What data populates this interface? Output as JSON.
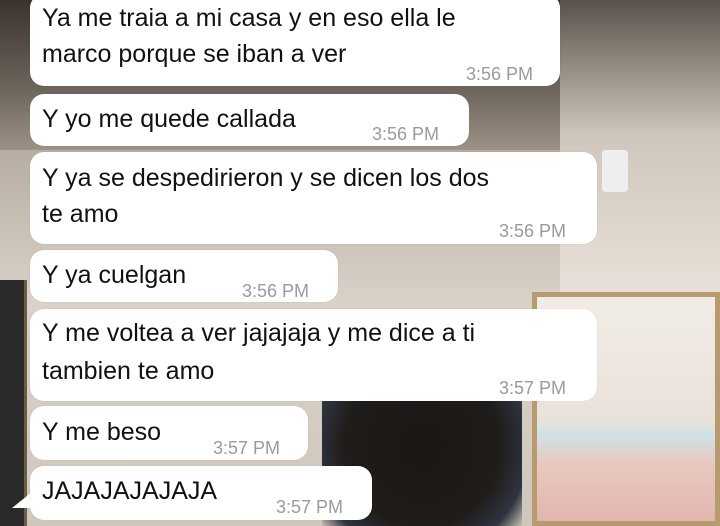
{
  "messages": [
    {
      "lines": [
        "Ya me traia a mi casa y en eso ella le",
        "marco porque se iban a ver"
      ],
      "time": "3:56 PM"
    },
    {
      "lines": [
        "Y yo me quede callada"
      ],
      "time": "3:56 PM"
    },
    {
      "lines": [
        "Y ya se despedirieron y se dicen los dos",
        "te amo"
      ],
      "time": "3:56 PM"
    },
    {
      "lines": [
        "Y ya cuelgan"
      ],
      "time": "3:56 PM"
    },
    {
      "lines": [
        "Y me voltea a ver jajajaja y me dice a ti",
        "tambien te amo"
      ],
      "time": "3:57 PM"
    },
    {
      "lines": [
        "Y me beso"
      ],
      "time": "3:57 PM"
    },
    {
      "lines": [
        "JAJAJAJAJAJA"
      ],
      "time": "3:57 PM"
    }
  ]
}
